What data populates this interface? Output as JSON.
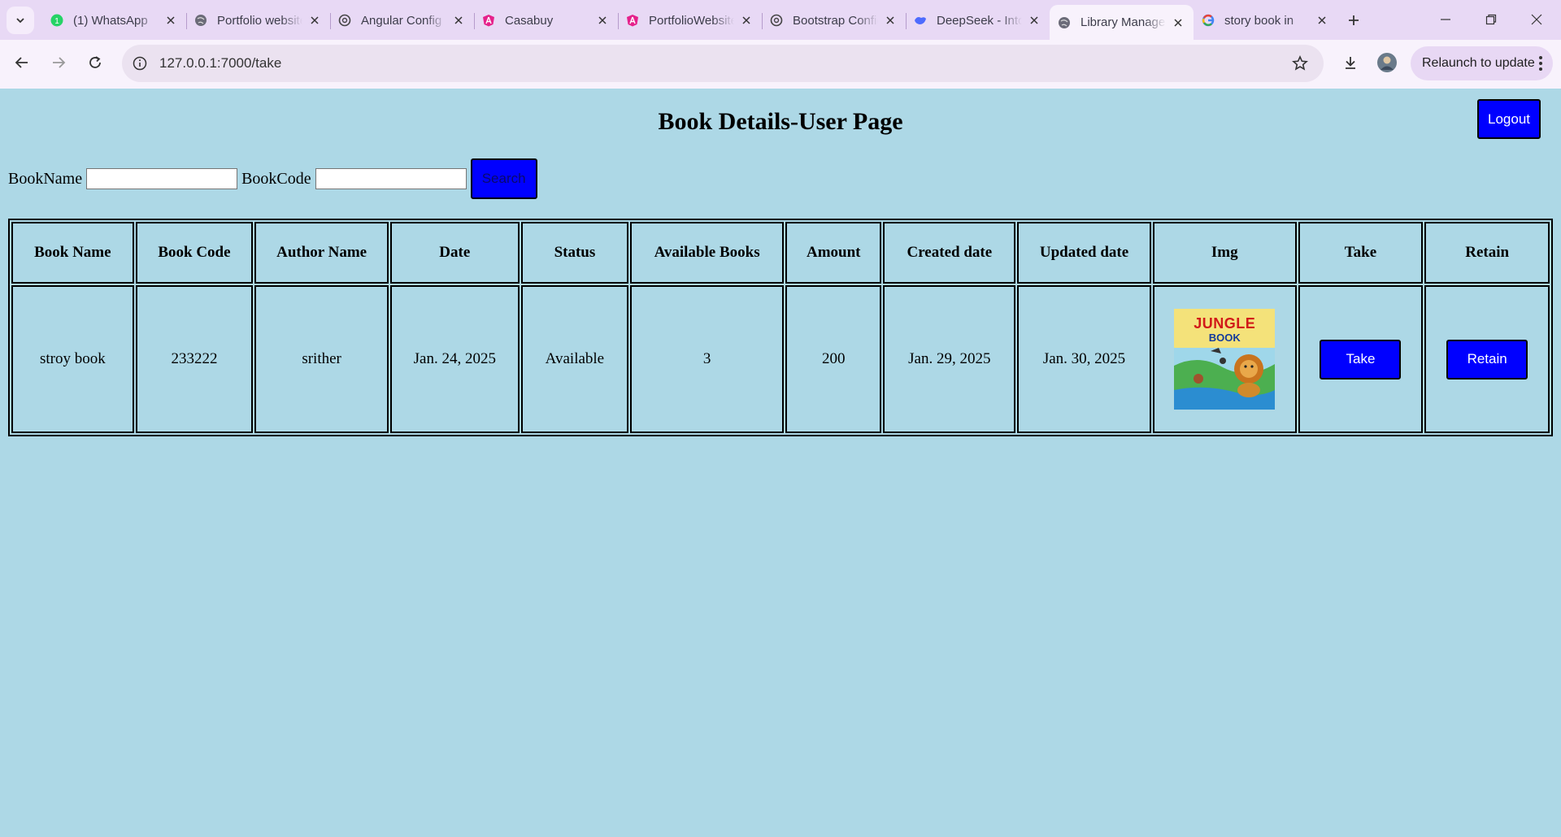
{
  "browser": {
    "tabs": [
      {
        "title": "(1) WhatsApp",
        "icon": "whatsapp-icon",
        "active": false
      },
      {
        "title": "Portfolio website",
        "icon": "globe-icon",
        "active": false
      },
      {
        "title": "Angular Config",
        "icon": "openai-icon",
        "active": false
      },
      {
        "title": "Casabuy",
        "icon": "angular-icon",
        "active": false
      },
      {
        "title": "PortfolioWebsite",
        "icon": "angular-icon",
        "active": false
      },
      {
        "title": "Bootstrap Config",
        "icon": "openai-icon",
        "active": false
      },
      {
        "title": "DeepSeek - Into",
        "icon": "deepseek-icon",
        "active": false
      },
      {
        "title": "Library Manager",
        "icon": "globe-icon",
        "active": true
      },
      {
        "title": "story book in",
        "icon": "google-icon",
        "active": false
      }
    ],
    "url": "127.0.0.1:7000/take",
    "relaunch_label": "Relaunch to update"
  },
  "page": {
    "title": "Book Details-User Page",
    "logout_label": "Logout",
    "search": {
      "bookname_label": "BookName",
      "bookcode_label": "BookCode",
      "bookname_value": "",
      "bookcode_value": "",
      "button_label": "Search"
    },
    "table": {
      "headers": [
        "Book Name",
        "Book Code",
        "Author Name",
        "Date",
        "Status",
        "Available Books",
        "Amount",
        "Created date",
        "Updated date",
        "Img",
        "Take",
        "Retain"
      ],
      "rows": [
        {
          "book_name": "stroy book",
          "book_code": "233222",
          "author_name": "srither",
          "date": "Jan. 24, 2025",
          "status": "Available",
          "available_books": "3",
          "amount": "200",
          "created_date": "Jan. 29, 2025",
          "updated_date": "Jan. 30, 2025",
          "img_title": "JUNGLE",
          "img_subtitle": "BOOK",
          "take_label": "Take",
          "retain_label": "Retain"
        }
      ]
    }
  },
  "colors": {
    "page_bg": "#add8e6",
    "button_bg": "#0000ff"
  }
}
